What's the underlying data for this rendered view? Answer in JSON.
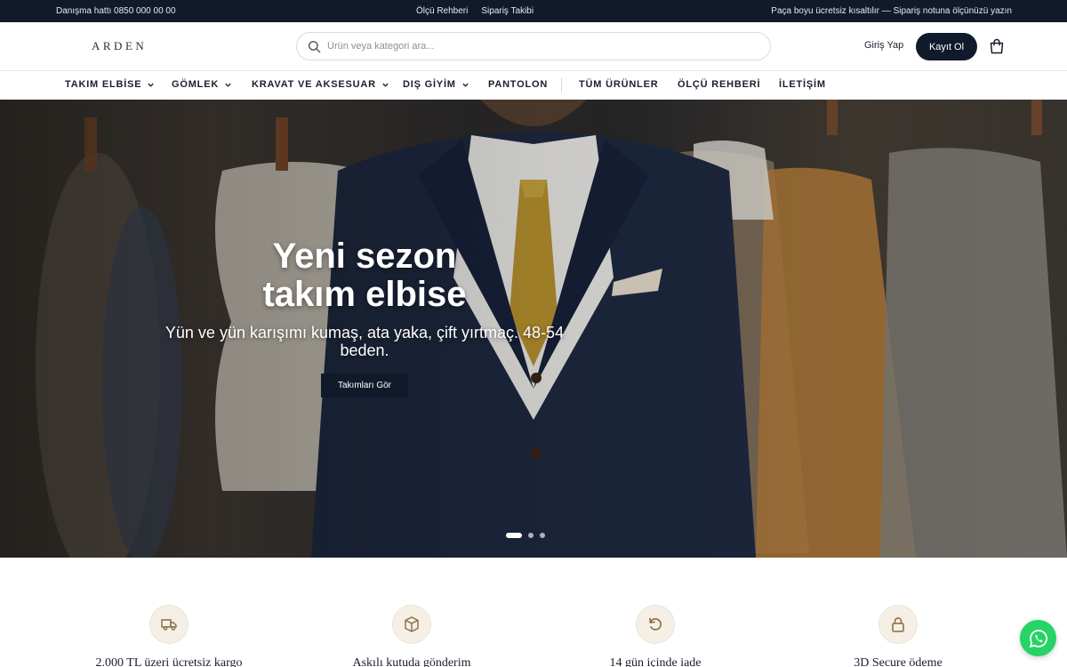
{
  "topbar": {
    "hotline": "Danışma hattı 0850 000 00 00",
    "links": [
      "Ölçü Rehberi",
      "Sipariş Takibi"
    ],
    "promo": "Paça boyu ücretsiz kısaltılır — Sipariş notuna ölçünüzü yazın"
  },
  "header": {
    "logo": "ARDEN",
    "search_placeholder": "Ürün veya kategori ara...",
    "login_label": "Giriş Yap",
    "register_label": "Kayıt Ol"
  },
  "nav": {
    "items": [
      {
        "label": "TAKIM ELBİSE",
        "has_dropdown": true
      },
      {
        "label": "GÖMLEK",
        "has_dropdown": true
      },
      {
        "label": "KRAVAT VE AKSESUAR",
        "has_dropdown": true
      },
      {
        "label": "DIŞ GİYİM",
        "has_dropdown": true
      },
      {
        "label": "PANTOLON",
        "has_dropdown": false
      },
      {
        "label": "TÜM ÜRÜNLER",
        "has_dropdown": false
      },
      {
        "label": "ÖLÇÜ REHBERİ",
        "has_dropdown": false
      },
      {
        "label": "İLETİŞİM",
        "has_dropdown": false
      }
    ]
  },
  "hero": {
    "title_line1": "Yeni sezon",
    "title_line2": "takım elbise",
    "subtitle": "Yün ve yün karışımı kumaş, ata yaka, çift yırtmaç. 48-54 beden.",
    "cta_label": "Takımları Gör",
    "slide_count": 3,
    "active_slide": 1
  },
  "features": [
    {
      "icon": "truck-icon",
      "label": "2.000 TL üzeri ücretsiz kargo"
    },
    {
      "icon": "box-icon",
      "label": "Askılı kutuda gönderim"
    },
    {
      "icon": "return-icon",
      "label": "14 gün içinde iade"
    },
    {
      "icon": "lock-icon",
      "label": "3D Secure ödeme"
    }
  ],
  "colors": {
    "navy": "#111a2b",
    "accent_beige": "#f5efe6",
    "icon_brown": "#8a6a3f",
    "whatsapp": "#25d366"
  }
}
